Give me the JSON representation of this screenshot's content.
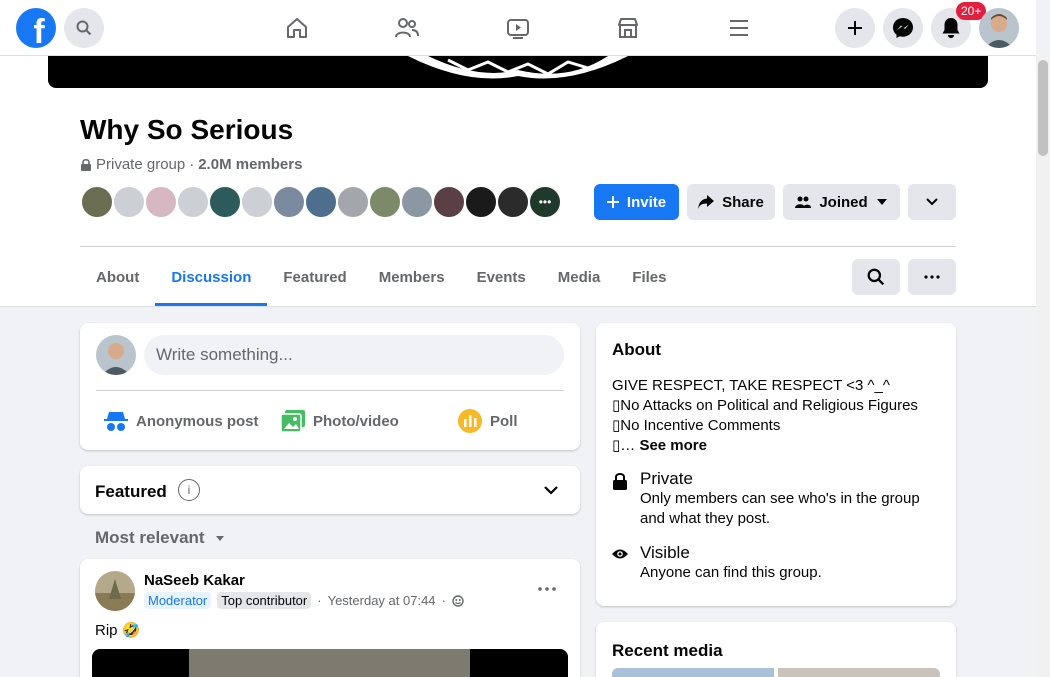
{
  "topbar": {
    "logo_letter": "f",
    "notification_badge": "20+",
    "icons": [
      "search-icon",
      "home-icon",
      "friends-icon",
      "watch-icon",
      "marketplace-icon",
      "menu-icon",
      "plus-icon",
      "messenger-icon",
      "bell-icon"
    ]
  },
  "group": {
    "title": "Why So Serious",
    "privacy": "Private group",
    "separator": "·",
    "members": "2.0M members"
  },
  "actions": {
    "invite": "Invite",
    "share": "Share",
    "joined": "Joined"
  },
  "tabs": [
    "About",
    "Discussion",
    "Featured",
    "Members",
    "Events",
    "Media",
    "Files"
  ],
  "active_tab": "Discussion",
  "composer": {
    "placeholder": "Write something...",
    "anonymous": "Anonymous post",
    "photo": "Photo/video",
    "poll": "Poll"
  },
  "featured": {
    "title": "Featured",
    "info": "i"
  },
  "sort": {
    "label": "Most relevant"
  },
  "post": {
    "author": "NaSeeb Kakar",
    "role": "Moderator",
    "badge": "Top contributor",
    "time": "Yesterday at 07:44",
    "dot": "·",
    "text": "Rip 🤣"
  },
  "about": {
    "title": "About",
    "line1": "GIVE RESPECT, TAKE RESPECT <3 ^_^",
    "line2": "No Attacks on Political and Religious Figures",
    "line3": "No Incentive Comments",
    "line4": "…",
    "see_more": "See more",
    "private_label": "Private",
    "private_desc": "Only members can see who's in the group and what they post.",
    "visible_label": "Visible",
    "visible_desc": "Anyone can find this group."
  },
  "recent_media": {
    "title": "Recent media"
  },
  "colors": {
    "brand": "#1877f2",
    "badge": "#e41e3f",
    "background": "#f0f2f5"
  }
}
